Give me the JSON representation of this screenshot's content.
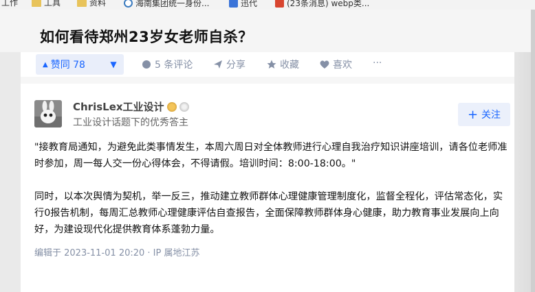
{
  "bookmarks": [
    {
      "label": "工作",
      "icon": "none"
    },
    {
      "label": "工具",
      "icon": "folder-icon"
    },
    {
      "label": "资料",
      "icon": "folder-icon"
    },
    {
      "label": "海南集团统一身份...",
      "icon": "swirl-icon"
    },
    {
      "label": "迅代",
      "icon": "r-icon"
    },
    {
      "label": "(23条消息) webp类...",
      "icon": "c-icon"
    }
  ],
  "question": {
    "title": "如何看待郑州23岁女老师自杀？"
  },
  "actions": {
    "vote_up": "赞同 78",
    "vote_up_arrow": "▲",
    "vote_down_arrow": "▼",
    "comments": "5 条评论",
    "share": "分享",
    "collect": "收藏",
    "like": "喜欢",
    "more": "···"
  },
  "answer": {
    "author_name": "ChrisLex工业设计",
    "author_desc": "工业设计话题下的优秀答主",
    "follow_label": "关注",
    "follow_plus": "+",
    "paragraphs": [
      "\"接教育局通知，为避免此类事情发生，本周六周日对全体教师进行心理自我治疗知识讲座培训，请各位老师准时参加，周一每人交一份心得体会，不得请假。培训时间：8:00-18:00。\"",
      "同时，以本次舆情为契机，举一反三，推动建立教师群体心理健康管理制度化，监督全程化，评估常态化，实行0报告机制，每周汇总教师心理健康评估自查报告，全面保障教师群体身心健康，助力教育事业发展向上向好，为建设现代化提供教育体系蓬勃力量。"
    ],
    "edited_meta": "编辑于 2023-11-01 20:20 · IP 属地江苏"
  },
  "colors": {
    "accent": "#1a66ff",
    "muted": "#8590a6",
    "vote_bg": "#e9eefa"
  }
}
